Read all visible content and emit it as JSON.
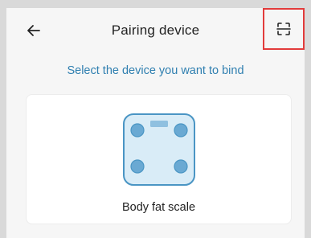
{
  "header": {
    "title": "Pairing device",
    "back_icon": "arrow-left-icon",
    "scan_icon": "scan-icon",
    "highlight_color": "#e23b3b"
  },
  "subtitle": "Select the device you want to bind",
  "devices": [
    {
      "name": "Body fat scale",
      "icon": "body-fat-scale-icon"
    }
  ],
  "colors": {
    "accent": "#2f7fb0",
    "scale_fill": "#d9ecf7",
    "scale_stroke": "#4a95c4",
    "scale_electrode": "#6aa9d3"
  }
}
